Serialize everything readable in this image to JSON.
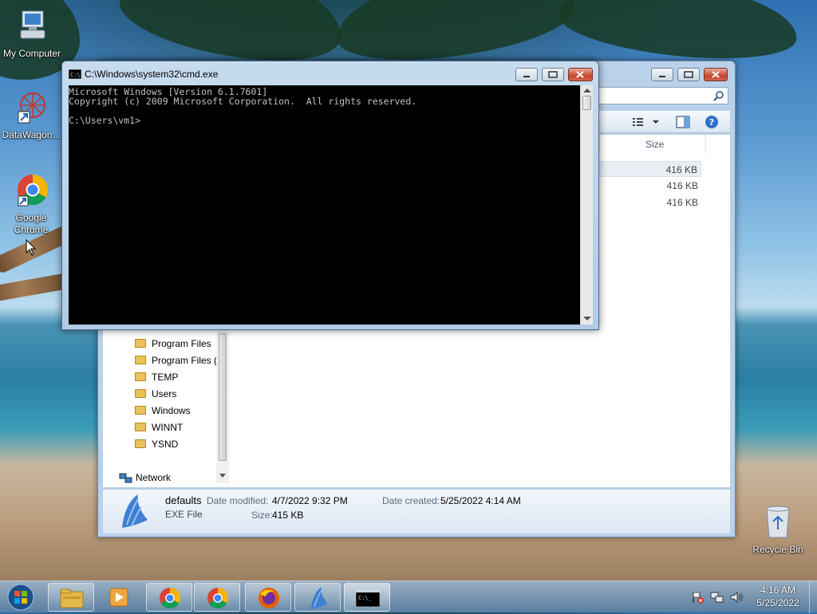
{
  "desktop": {
    "icons": [
      {
        "label": "My Computer",
        "icon": "computer-icon"
      },
      {
        "label": "DataWagon...",
        "icon": "datawagon-shortcut-icon"
      },
      {
        "label": "Google Chrome",
        "icon": "chrome-shortcut-icon"
      },
      {
        "label": "Recycle Bin",
        "icon": "recycle-bin-icon"
      }
    ]
  },
  "cmd": {
    "title": "C:\\Windows\\system32\\cmd.exe",
    "lines": [
      "Microsoft Windows [Version 6.1.7601]",
      "Copyright (c) 2009 Microsoft Corporation.  All rights reserved.",
      "",
      "C:\\Users\\vm1>"
    ]
  },
  "explorer": {
    "column_header": "Size",
    "rows": [
      {
        "size": "416 KB"
      },
      {
        "size": "416 KB"
      },
      {
        "size": "416 KB"
      }
    ],
    "tree": [
      {
        "label": "Program Files"
      },
      {
        "label": "Program Files ("
      },
      {
        "label": "TEMP"
      },
      {
        "label": "Users"
      },
      {
        "label": "Windows"
      },
      {
        "label": "WINNT"
      },
      {
        "label": "YSND"
      }
    ],
    "network_label": "Network",
    "details": {
      "name": "defaults",
      "type": "EXE File",
      "date_modified_label": "Date modified:",
      "date_modified": "4/7/2022 9:32 PM",
      "date_created_label": "Date created:",
      "date_created": "5/25/2022 4:14 AM",
      "size_label": "Size:",
      "size": "415 KB"
    }
  },
  "taskbar": {
    "items": [
      {
        "icon": "start-orb-icon"
      },
      {
        "icon": "windows-explorer-icon"
      },
      {
        "icon": "media-player-icon"
      },
      {
        "icon": "chrome-icon"
      },
      {
        "icon": "chrome-icon"
      },
      {
        "icon": "firefox-icon"
      },
      {
        "icon": "app-shark-icon"
      },
      {
        "icon": "cmd-icon"
      }
    ],
    "clock_time": "4:16 AM",
    "clock_date": "5/25/2022"
  }
}
